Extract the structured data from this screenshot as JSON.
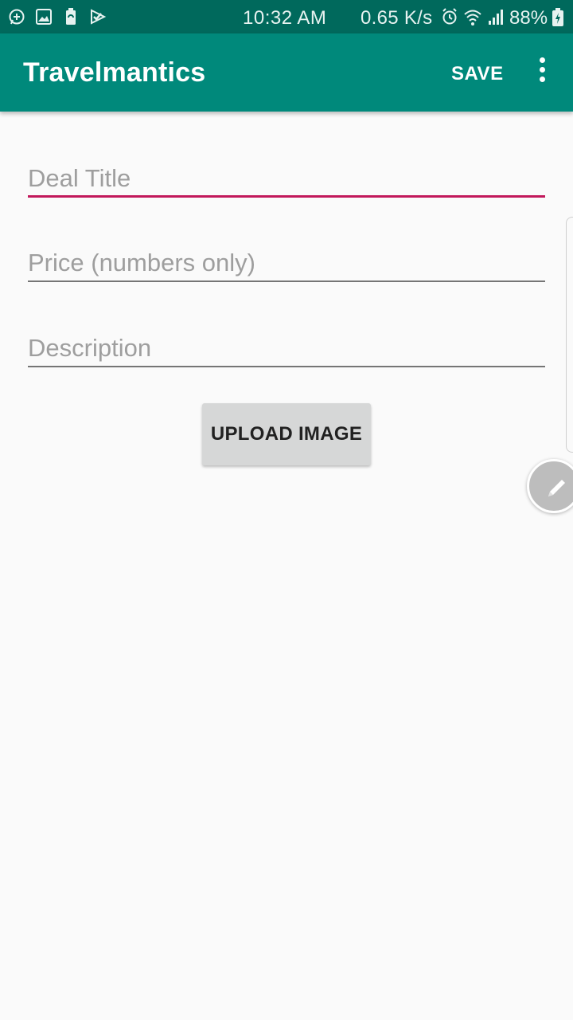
{
  "status_bar": {
    "time": "10:32 AM",
    "network_speed": "0.65 K/s",
    "battery_percent": "88%",
    "left_icons": [
      "whatsapp-icon",
      "gallery-icon",
      "battery-saver-icon",
      "check-icon"
    ],
    "right_icons": [
      "alarm-icon",
      "wifi-icon",
      "signal-icon",
      "battery-charging-icon"
    ]
  },
  "app_bar": {
    "title": "Travelmantics",
    "save_label": "SAVE",
    "overflow_icon": "more-vert-icon"
  },
  "form": {
    "title_field": {
      "placeholder": "Deal Title",
      "value": ""
    },
    "price_field": {
      "placeholder": "Price (numbers only)",
      "value": ""
    },
    "description_field": {
      "placeholder": "Description",
      "value": ""
    },
    "upload_button_label": "UPLOAD IMAGE"
  },
  "colors": {
    "status_bar": "#00695c",
    "app_bar": "#00897b",
    "accent": "#c2185b",
    "background": "#fafafa"
  }
}
